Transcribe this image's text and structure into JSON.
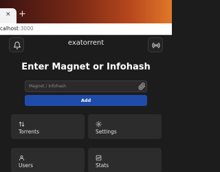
{
  "browser": {
    "close_glyph": "×",
    "new_tab_glyph": "+",
    "url_host": "calhost",
    "url_port": ":3000"
  },
  "app": {
    "title": "exatorrent",
    "bell_icon": "bell-icon",
    "broadcast_icon": "broadcast-icon"
  },
  "hero": {
    "heading": "Enter Magnet or Infohash"
  },
  "magnet": {
    "placeholder": "Magnet / Infohash",
    "value": "",
    "attach_icon": "paperclip-icon"
  },
  "add_button": {
    "label": "Add"
  },
  "cards": [
    {
      "label": "Torrents",
      "icon": "sort-arrows-icon"
    },
    {
      "label": "Settings",
      "icon": "gear-icon"
    },
    {
      "label": "Users",
      "icon": "users-icon"
    },
    {
      "label": "Stats",
      "icon": "chart-icon"
    }
  ],
  "colors": {
    "background": "#1c1c1c",
    "card": "#2c2c2c",
    "accent": "#1f4ca8"
  }
}
